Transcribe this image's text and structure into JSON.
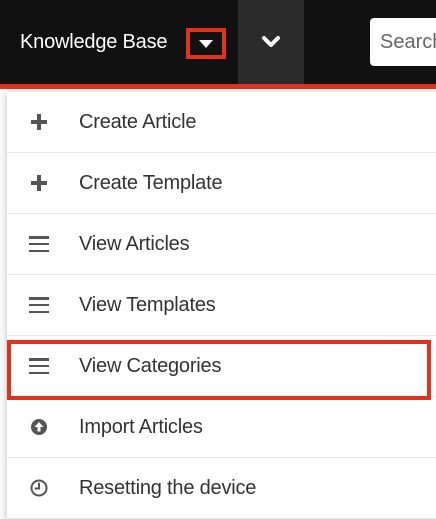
{
  "topbar": {
    "module_label": "Knowledge Base",
    "search_placeholder": "Search",
    "accent_color": "#e0321c"
  },
  "menu": {
    "items": [
      {
        "label": "Create Article",
        "icon": "plus-icon"
      },
      {
        "label": "Create Template",
        "icon": "plus-icon"
      },
      {
        "label": "View Articles",
        "icon": "list-icon"
      },
      {
        "label": "View Templates",
        "icon": "list-icon"
      },
      {
        "label": "View Categories",
        "icon": "list-icon",
        "highlighted": true
      },
      {
        "label": "Import Articles",
        "icon": "upload-circle-icon"
      },
      {
        "label": "Resetting the device",
        "icon": "clock-icon"
      }
    ]
  }
}
